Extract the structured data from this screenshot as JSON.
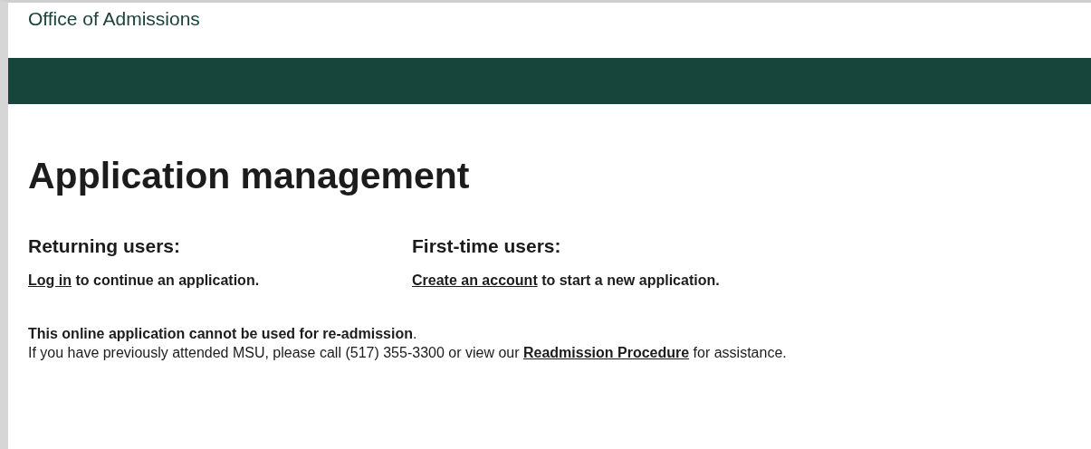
{
  "header": {
    "title": "Office of Admissions"
  },
  "page_title": "Application management",
  "columns": [
    {
      "heading": "Returning users:",
      "link": "Log in",
      "text": " to continue an application."
    },
    {
      "heading": "First-time users:",
      "link": "Create an account",
      "text": " to start a new application."
    }
  ],
  "notice": {
    "statement": "**This online application cannot be used for re-admission**.",
    "before": "If you have previously attended MSU, please call (517) 355-3300 or view our ",
    "link": "Readmission Procedure",
    "after": " for assistance."
  }
}
